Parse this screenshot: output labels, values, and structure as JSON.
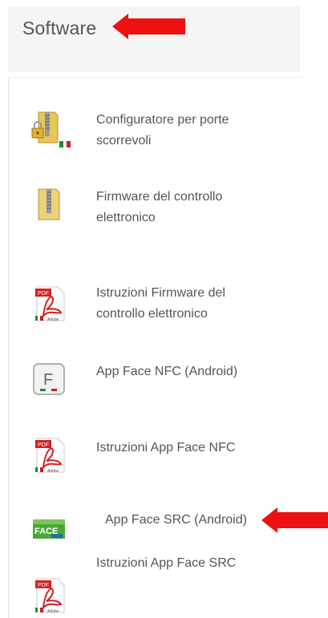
{
  "header": {
    "title": "Software"
  },
  "items": [
    {
      "label_lines": [
        "Configuratore per porte",
        "scorrevoli"
      ],
      "icon": "locked-folder-icon"
    },
    {
      "label_lines": [
        "Firmware del controllo",
        "elettronico"
      ],
      "icon": "zip-folder-icon"
    },
    {
      "label_lines": [
        "Istruzioni Firmware del",
        "controllo elettronico"
      ],
      "icon": "pdf-icon"
    },
    {
      "label_lines": [
        "App Face NFC (Android)"
      ],
      "icon": "face-app-icon",
      "icon_text": "F"
    },
    {
      "label_lines": [
        "Istruzioni App Face NFC"
      ],
      "icon": "pdf-icon"
    },
    {
      "label_lines": [
        "App Face SRC (Android)"
      ],
      "icon": "face-src-app-icon",
      "icon_text": "FACE"
    },
    {
      "label_lines": [
        "Istruzioni App Face SRC"
      ],
      "icon": "pdf-icon"
    }
  ],
  "pdf_badge": "PDF",
  "adobe_badge": "Adobe",
  "colors": {
    "arrow": "#ee1111",
    "text": "#555555",
    "header_bg": "#f5f5f5"
  }
}
